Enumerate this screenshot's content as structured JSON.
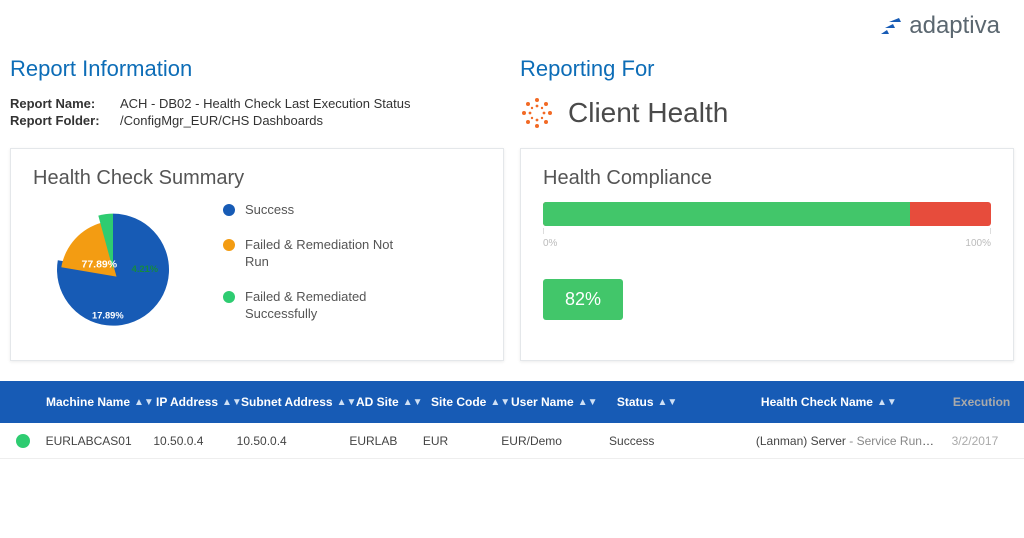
{
  "brand": {
    "name": "adaptiva"
  },
  "report_info": {
    "title": "Report Information",
    "rows": [
      {
        "label": "Report Name:",
        "value": "ACH - DB02 - Health Check Last Execution Status"
      },
      {
        "label": "Report Folder:",
        "value": "/ConfigMgr_EUR/CHS Dashboards"
      }
    ]
  },
  "reporting_for": {
    "title": "Reporting For",
    "product": "Client Health"
  },
  "summary_card": {
    "title": "Health Check Summary",
    "legend": [
      {
        "label": "Success",
        "color": "#175bb5"
      },
      {
        "label": "Failed & Remediation Not Run",
        "color": "#f39c12"
      },
      {
        "label": "Failed & Remediated Successfully",
        "color": "#2ecc71"
      }
    ]
  },
  "compliance_card": {
    "title": "Health Compliance",
    "scale_min": "0%",
    "scale_max": "100%",
    "badge": "82%"
  },
  "chart_data": {
    "type": "pie",
    "title": "Health Check Summary",
    "series": [
      {
        "name": "Success",
        "value": 77.89,
        "color": "#175bb5",
        "label": "77.89%"
      },
      {
        "name": "Failed & Remediation Not Run",
        "value": 17.89,
        "color": "#f39c12",
        "label": "17.89%"
      },
      {
        "name": "Failed & Remediated Successfully",
        "value": 4.21,
        "color": "#2ecc71",
        "label": "4.21%"
      }
    ],
    "compliance": {
      "type": "bar",
      "value": 82,
      "max": 100,
      "unit": "%",
      "colors": {
        "pass": "#42c66a",
        "fail": "#e74c3c"
      }
    }
  },
  "table": {
    "columns": [
      "Machine Name",
      "IP Address",
      "Subnet Address",
      "AD Site",
      "Site Code",
      "User Name",
      "Status",
      "Health Check Name",
      "Execution"
    ],
    "rows": [
      {
        "status_color": "#2ecc71",
        "machine": "EURLABCAS01",
        "ip": "10.50.0.4",
        "subnet": "10.50.0.4",
        "adsite": "EURLAB",
        "sitecode": "EUR",
        "user": "EUR/Demo",
        "status": "Success",
        "health_check": "(Lanman) Server",
        "health_check_suffix": " - Service Running",
        "exec": "3/2/2017"
      }
    ]
  }
}
